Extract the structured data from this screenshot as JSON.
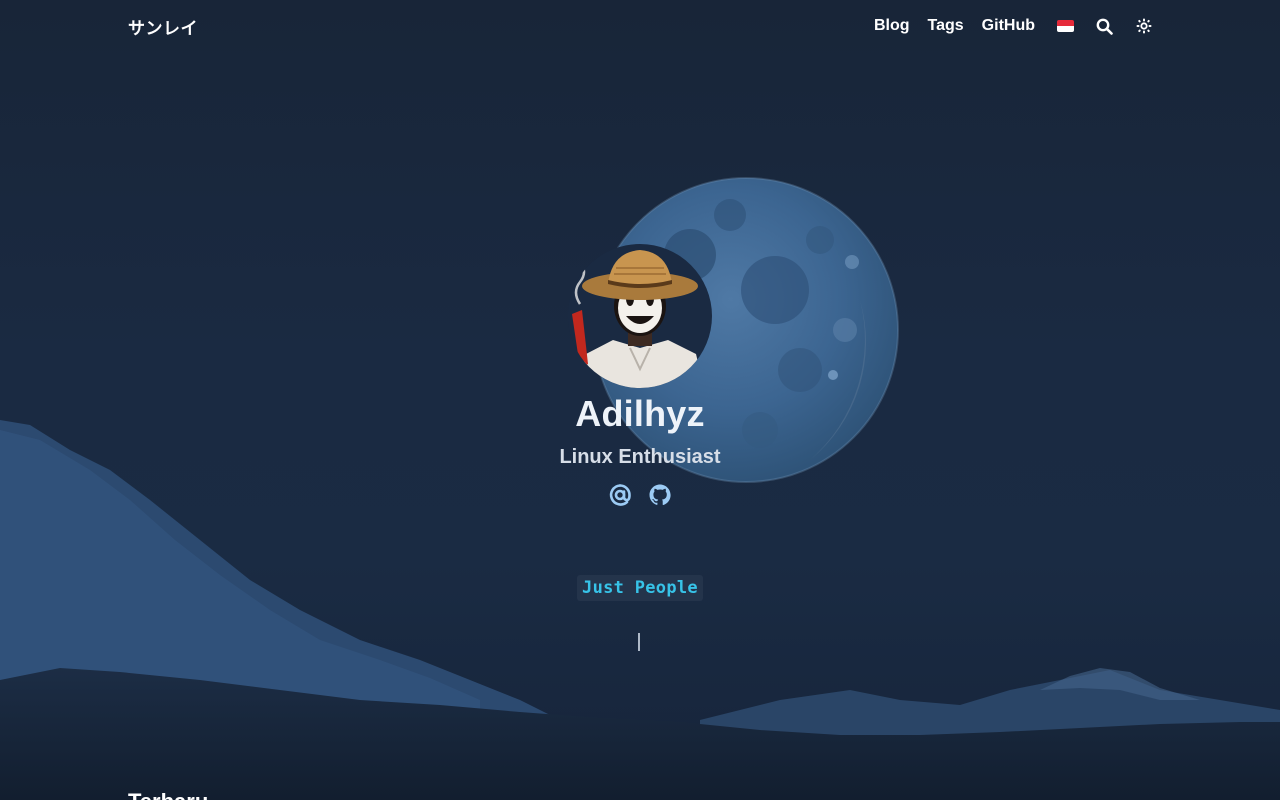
{
  "header": {
    "brand": "サンレイ",
    "nav": [
      {
        "label": "Blog"
      },
      {
        "label": "Tags"
      },
      {
        "label": "GitHub"
      }
    ],
    "icons": {
      "language": "indonesia-flag-icon",
      "search": "search-icon",
      "theme": "sun-icon"
    }
  },
  "profile": {
    "name": "Adilhyz",
    "tagline": "Linux Enthusiast",
    "socials": [
      {
        "icon": "at-sign-icon"
      },
      {
        "icon": "github-icon"
      }
    ]
  },
  "typing": {
    "text": "Just People"
  },
  "section": {
    "title": "Terbaru"
  },
  "colors": {
    "background": "#17253a",
    "accent": "#37c3e8",
    "social_icon": "#9ccbf4"
  }
}
